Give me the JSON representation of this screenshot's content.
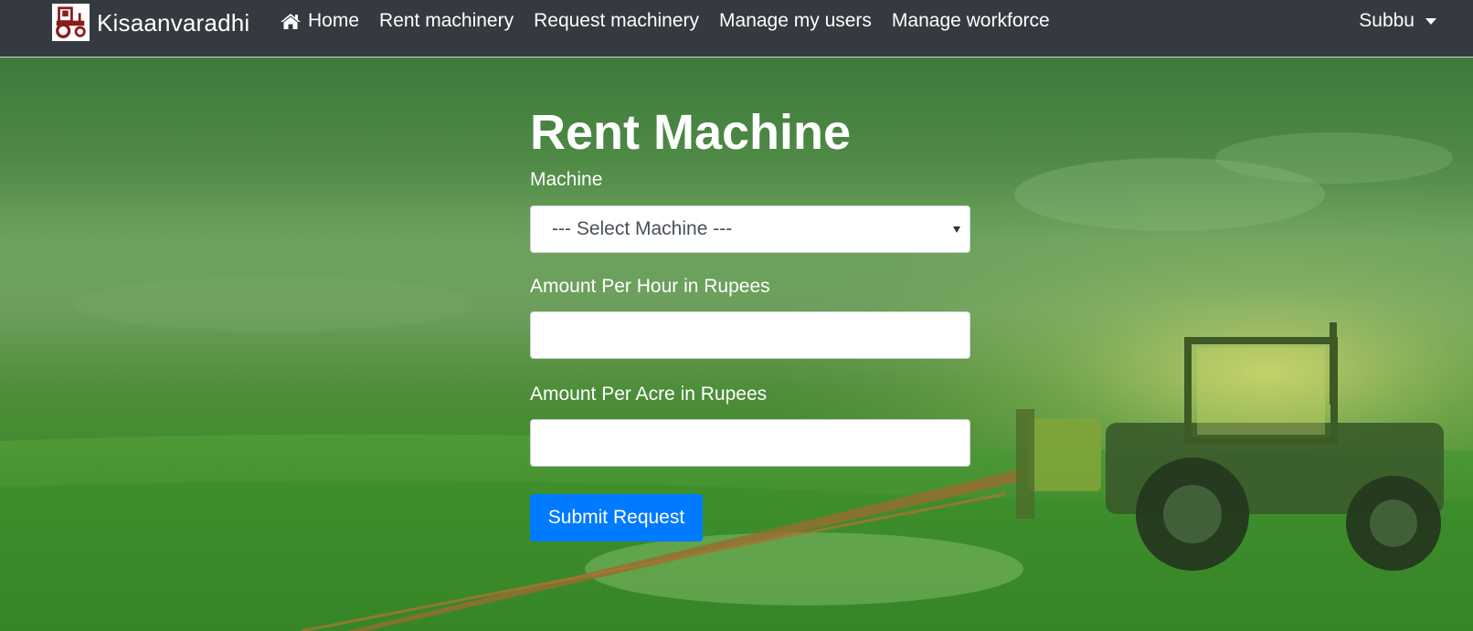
{
  "navbar": {
    "brand": "Kisaanvaradhi",
    "brand_icon": "tractor-icon",
    "links": [
      {
        "label": "Home",
        "icon": "home-icon"
      },
      {
        "label": "Rent machinery"
      },
      {
        "label": "Request machinery"
      },
      {
        "label": "Manage my users"
      },
      {
        "label": "Manage workforce"
      }
    ],
    "user": "Subbu"
  },
  "form": {
    "title": "Rent Machine",
    "machine_label": "Machine",
    "machine_selected": "--- Select Machine ---",
    "hour_label": "Amount Per Hour in Rupees",
    "hour_value": "",
    "acre_label": "Amount Per Acre in Rupees",
    "acre_value": "",
    "submit_label": "Submit Request"
  },
  "colors": {
    "navbar_bg": "#343a40",
    "primary_button": "#007bff",
    "brand_icon": "#8b1c1c"
  }
}
